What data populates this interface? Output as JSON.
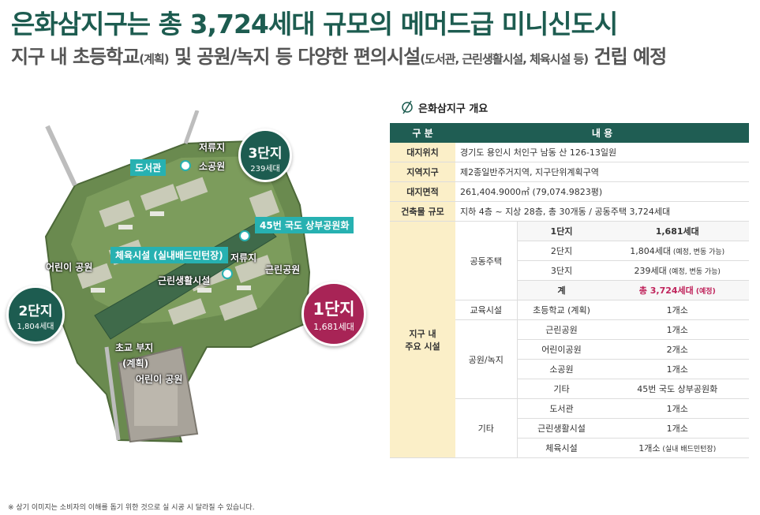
{
  "header": {
    "title": "은화삼지구는 총 3,724세대 규모의 메머드급 미니신도시",
    "subtitle_a": "지구 내 초등학교",
    "subtitle_a_small": "(계획)",
    "subtitle_b": " 및 공원/녹지 등 다양한 편의시설",
    "subtitle_b_small": "(도서관, 근린생활시설, 체육시설 등)",
    "subtitle_c": " 건립 예정"
  },
  "map": {
    "labels": {
      "library": "도서관",
      "reservoir1": "저류지",
      "small_park": "소공원",
      "highway_park": "45번 국도 상부공원화",
      "sports": "체육시설 (실내배드민턴장)",
      "reservoir2": "저류지",
      "kids_park_w": "어린이 공원",
      "neighborhood_park": "근린공원",
      "neighborhood_facility": "근린생활시설",
      "elementary": "초교 부지",
      "elementary_plan": "(계획)",
      "kids_park_s": "어린이 공원"
    },
    "bubbles": {
      "complex3": {
        "name": "3단지",
        "units": "239세대"
      },
      "complex2": {
        "name": "2단지",
        "units": "1,804세대"
      },
      "complex1": {
        "name": "1단지",
        "units": "1,681세대"
      }
    }
  },
  "overview": {
    "title": "은화삼지구 개요",
    "headers": {
      "col1": "구 분",
      "col2": "내 용"
    },
    "rows": {
      "location": {
        "key": "대지위치",
        "value": "경기도 용인시 처인구 남동 산 126-13일원"
      },
      "zone": {
        "key": "지역지구",
        "value": "제2종일반주거지역, 지구단위계획구역"
      },
      "area": {
        "key": "대지면적",
        "value": "261,404.9000㎡ (79,074.9823평)"
      },
      "scale": {
        "key": "건축물 규모",
        "value": "지하 4층 ~ 지상 28층, 총 30개동 / 공동주택 3,724세대"
      }
    },
    "facilities_key_line1": "지구 내",
    "facilities_key_line2": "주요 시설",
    "housing": {
      "group": "공동주택",
      "items": [
        {
          "name": "1단지",
          "value": "1,681세대",
          "note": ""
        },
        {
          "name": "2단지",
          "value": "1,804세대",
          "note": " (예정, 변동 가능)"
        },
        {
          "name": "3단지",
          "value": "239세대",
          "note": " (예정, 변동 가능)"
        }
      ],
      "total_label": "계",
      "total_value": "총 3,724세대",
      "total_note": " (예정)"
    },
    "education": {
      "group": "교육시설",
      "name": "초등학교 (계획)",
      "value": "1개소"
    },
    "parks": {
      "group": "공원/녹지",
      "items": [
        {
          "name": "근린공원",
          "value": "1개소"
        },
        {
          "name": "어린이공원",
          "value": "2개소"
        },
        {
          "name": "소공원",
          "value": "1개소"
        },
        {
          "name": "기타",
          "value": "45번 국도 상부공원화"
        }
      ]
    },
    "others": {
      "group": "기타",
      "items": [
        {
          "name": "도서관",
          "value": "1개소",
          "note": ""
        },
        {
          "name": "근린생활시설",
          "value": "1개소",
          "note": ""
        },
        {
          "name": "체육시설",
          "value": "1개소",
          "note": " (실내 배드민턴장)"
        }
      ]
    }
  },
  "footer": "※ 상기 이미지는 소비자의 이해를 돕기 위한 것으로 실 시공 시 달라질 수 있습니다.",
  "colors": {
    "brand": "#1d5c50",
    "teal": "#27b1b1",
    "accent": "#c0245c",
    "key_bg": "#fbefc8"
  }
}
